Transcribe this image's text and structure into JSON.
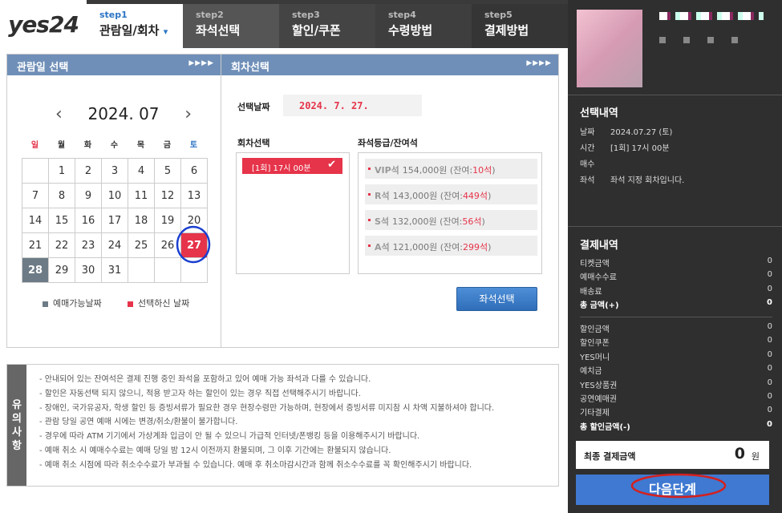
{
  "logo": "yes24",
  "steps": [
    {
      "num": "step1",
      "label": "관람일/회차"
    },
    {
      "num": "step2",
      "label": "좌석선택"
    },
    {
      "num": "step3",
      "label": "할인/쿠폰"
    },
    {
      "num": "step4",
      "label": "수령방법"
    },
    {
      "num": "step5",
      "label": "결제방법"
    }
  ],
  "date_panel": {
    "title": "관람일 선택",
    "month": "2024. 07",
    "prev_icon": "‹",
    "next_icon": "›",
    "dow": [
      "일",
      "월",
      "화",
      "수",
      "목",
      "금",
      "토"
    ],
    "weeks": [
      [
        "",
        "1",
        "2",
        "3",
        "4",
        "5",
        "6"
      ],
      [
        "7",
        "8",
        "9",
        "10",
        "11",
        "12",
        "13"
      ],
      [
        "14",
        "15",
        "16",
        "17",
        "18",
        "19",
        "20"
      ],
      [
        "21",
        "22",
        "23",
        "24",
        "25",
        "26",
        "27"
      ],
      [
        "28",
        "29",
        "30",
        "31",
        "",
        "",
        ""
      ]
    ],
    "selected_day": "27",
    "today_day": "28",
    "legend_available": "예매가능날짜",
    "legend_selected": "선택하신 날짜"
  },
  "session_panel": {
    "title": "회차선택",
    "date_label": "선택날짜",
    "date_value": "2024. 7. 27.",
    "round_label": "회차선택",
    "round_value": "[1회] 17시 00분",
    "grade_label": "좌석등급/잔여석",
    "grades": [
      {
        "name": "VIP석",
        "price": "154,000원",
        "left": "10석"
      },
      {
        "name": "R석",
        "price": "143,000원",
        "left": "449석"
      },
      {
        "name": "S석",
        "price": "132,000원",
        "left": "56석"
      },
      {
        "name": "A석",
        "price": "121,000원",
        "left": "299석"
      }
    ],
    "seat_button": "좌석선택"
  },
  "notice": {
    "side": "유의사항",
    "items": [
      "- 안내되어 있는 잔여석은 결제 진행 중인 좌석을 포함하고 있어 예매 가능 좌석과 다를 수 있습니다.",
      "- 할인은 자동선택 되지 않으니, 적용 받고자 하는 할인이 있는 경우 직접 선택해주시기 바랍니다.",
      "- 장애인, 국가유공자, 학생 할인 등 증빙서류가 필요한 경우 현장수령만 가능하며, 현장에서 증빙서류 미지참 시 차액 지불하셔야 합니다.",
      "- 관람 당일 공연 예매 시에는 변경/취소/환불이 불가합니다.",
      "- 경우에 따라 ATM 기기에서 가상계좌 입금이 안 될 수 있으니 가급적 인터넷/폰뱅킹 등을 이용해주시기 바랍니다.",
      "- 예매 취소 시 예매수수료는 예매 당일 밤 12시 이전까지 환불되며, 그 이후 기간에는 환불되지 않습니다.",
      "- 예매 취소 시점에 따라 취소수수료가 부과될 수 있습니다. 예매 후 취소마감시간과 함께 취소수수료를 꼭 확인해주시기 바랍니다."
    ]
  },
  "summary": {
    "title": "선택내역",
    "rows": [
      {
        "label": "날짜",
        "value": "2024.07.27 (토)"
      },
      {
        "label": "시간",
        "value": "[1회] 17시 00분"
      },
      {
        "label": "매수",
        "value": ""
      },
      {
        "label": "좌석",
        "value": "좌석 지정 회차입니다."
      }
    ]
  },
  "payment": {
    "title": "결제내역",
    "fees": [
      {
        "label": "티켓금액",
        "value": "0"
      },
      {
        "label": "예매수수료",
        "value": "0"
      },
      {
        "label": "배송료",
        "value": "0"
      },
      {
        "label": "총 금액(+)",
        "value": "0"
      }
    ],
    "discounts": [
      {
        "label": "할인금액",
        "value": "0"
      },
      {
        "label": "할인쿠폰",
        "value": "0"
      },
      {
        "label": "YES머니",
        "value": "0"
      },
      {
        "label": "예치금",
        "value": "0"
      },
      {
        "label": "YES상품권",
        "value": "0"
      },
      {
        "label": "공연예매권",
        "value": "0"
      },
      {
        "label": "기타결제",
        "value": "0"
      },
      {
        "label": "총 할인금액(-)",
        "value": "0"
      }
    ],
    "final_label": "최종 결제금액",
    "final_value": "0",
    "final_unit": "원"
  },
  "next_button": "다음단계"
}
